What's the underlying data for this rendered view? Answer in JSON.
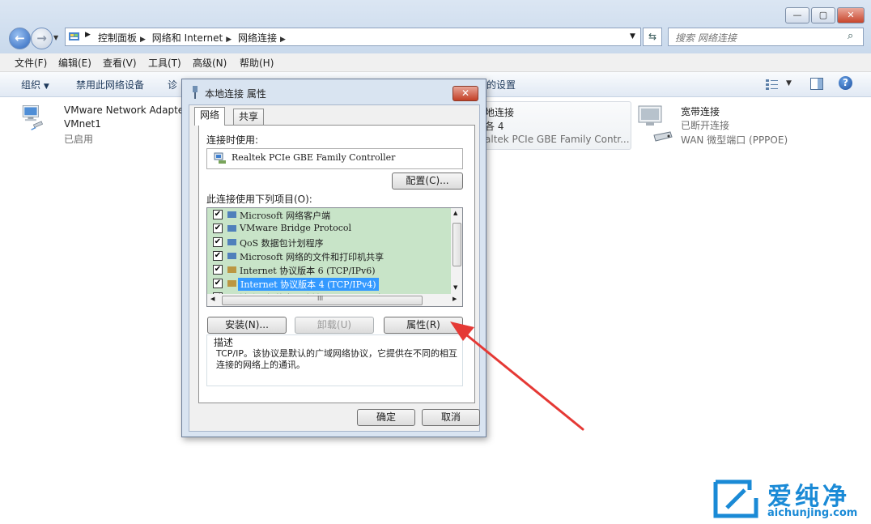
{
  "window": {
    "caption_buttons": {
      "minimize": "—",
      "maximize": "▢",
      "close": "✕"
    },
    "breadcrumbs": [
      "控制面板",
      "网络和 Internet",
      "网络连接"
    ],
    "search_placeholder": "搜索 网络连接"
  },
  "menubar": [
    "文件(F)",
    "编辑(E)",
    "查看(V)",
    "工具(T)",
    "高级(N)",
    "帮助(H)"
  ],
  "command_bar": {
    "organize": "组织",
    "disable": "禁用此网络设备",
    "diagnose": "诊",
    "settings_tail": "的设置"
  },
  "connections": [
    {
      "name": "VMware Network Adapte",
      "network": "VMnet1",
      "status": "已启用"
    },
    {
      "name": "地连接",
      "network": "各 4",
      "status": "altek PCIe GBE Family Contr..."
    },
    {
      "name": "宽带连接",
      "network": "已断开连接",
      "status": "WAN 微型端口 (PPPOE)"
    }
  ],
  "dialog": {
    "title": "本地连接 属性",
    "close": "✕",
    "tabs": [
      "网络",
      "共享"
    ],
    "connect_using_label": "连接时使用:",
    "adapter": "Realtek PCIe GBE Family Controller",
    "configure_button": "配置(C)...",
    "items_label": "此连接使用下列项目(O):",
    "items": [
      {
        "label": "Microsoft 网络客户端",
        "checked": true
      },
      {
        "label": "VMware Bridge Protocol",
        "checked": true
      },
      {
        "label": "QoS 数据包计划程序",
        "checked": true
      },
      {
        "label": "Microsoft 网络的文件和打印机共享",
        "checked": true
      },
      {
        "label": "Internet 协议版本 6 (TCP/IPv6)",
        "checked": true
      },
      {
        "label": "Internet 协议版本 4 (TCP/IPv4)",
        "checked": true,
        "selected": true
      },
      {
        "label": "链路层拓扑发现映射器 I/O 驱动程序",
        "checked": true
      }
    ],
    "check_mark": "✔",
    "hscroll_grip": "III",
    "install_button": "安装(N)...",
    "uninstall_button": "卸载(U)",
    "properties_button": "属性(R)",
    "description_label": "描述",
    "description": "TCP/IP。该协议是默认的广域网络协议，它提供在不同的相互连接的网络上的通讯。",
    "ok_button": "确定",
    "cancel_button": "取消"
  },
  "watermark": {
    "brand": "爱纯净",
    "url": "aichunjing.com"
  },
  "colors": {
    "arrow": "#e53935",
    "selection": "#3399ff",
    "list_bg": "#c8e4c8",
    "brand_blue": "#1a8ad6"
  }
}
